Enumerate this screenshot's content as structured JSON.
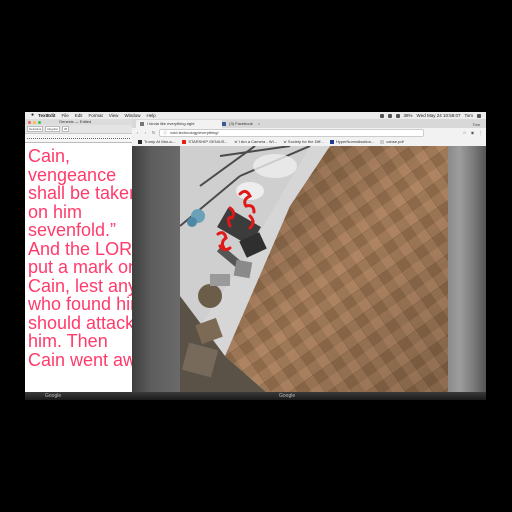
{
  "menubar": {
    "apple": "",
    "app": "TextEdit",
    "items": [
      "File",
      "Edit",
      "Format",
      "View",
      "Window",
      "Help"
    ],
    "clock": "Wed May 24  10:58:07",
    "battery": "38%",
    "user": "Tom"
  },
  "textedit": {
    "title": "Genesis — Edited",
    "toolbar": [
      "Helvetica",
      "Regular",
      "36"
    ],
    "lines": [
      "Cain,",
      "vengeance",
      "shall be taken",
      "on him",
      "sevenfold.”",
      "And the LORD",
      "put a mark on",
      "Cain, lest any",
      "who found him",
      "should attack",
      "him. Then",
      "Cain went awa"
    ]
  },
  "browser": {
    "tabs": [
      {
        "label": "I kinda like everything.right",
        "favicon_color": "#777777"
      },
      {
        "label": "(3) Facebook",
        "favicon_color": "#3b5998"
      }
    ],
    "profile": "Tom",
    "url": "void.technology/everything/",
    "bookmarks": [
      {
        "label": "Trump At Mar-a-...",
        "favicon_color": "#2a2a2a"
      },
      {
        "label": "STARSHIP GENIUS...",
        "favicon_color": "#e62117"
      },
      {
        "label": "‘a’ I Am a Camera - Wi...",
        "favicon_color": "#888888"
      },
      {
        "label": "‘a’ Society for the Diff...",
        "favicon_color": "#888888"
      },
      {
        "label": "HyperNormalisation...",
        "favicon_color": "#1e3c8c"
      },
      {
        "label": "canse.pdf",
        "favicon_color": "#cccccc"
      }
    ]
  },
  "colors": {
    "poem_text": "#ff3b6b",
    "floor": "#9a7456",
    "red_scribble": "#e01818"
  },
  "dock": {
    "left_label": "Google",
    "right_label": "Google"
  }
}
